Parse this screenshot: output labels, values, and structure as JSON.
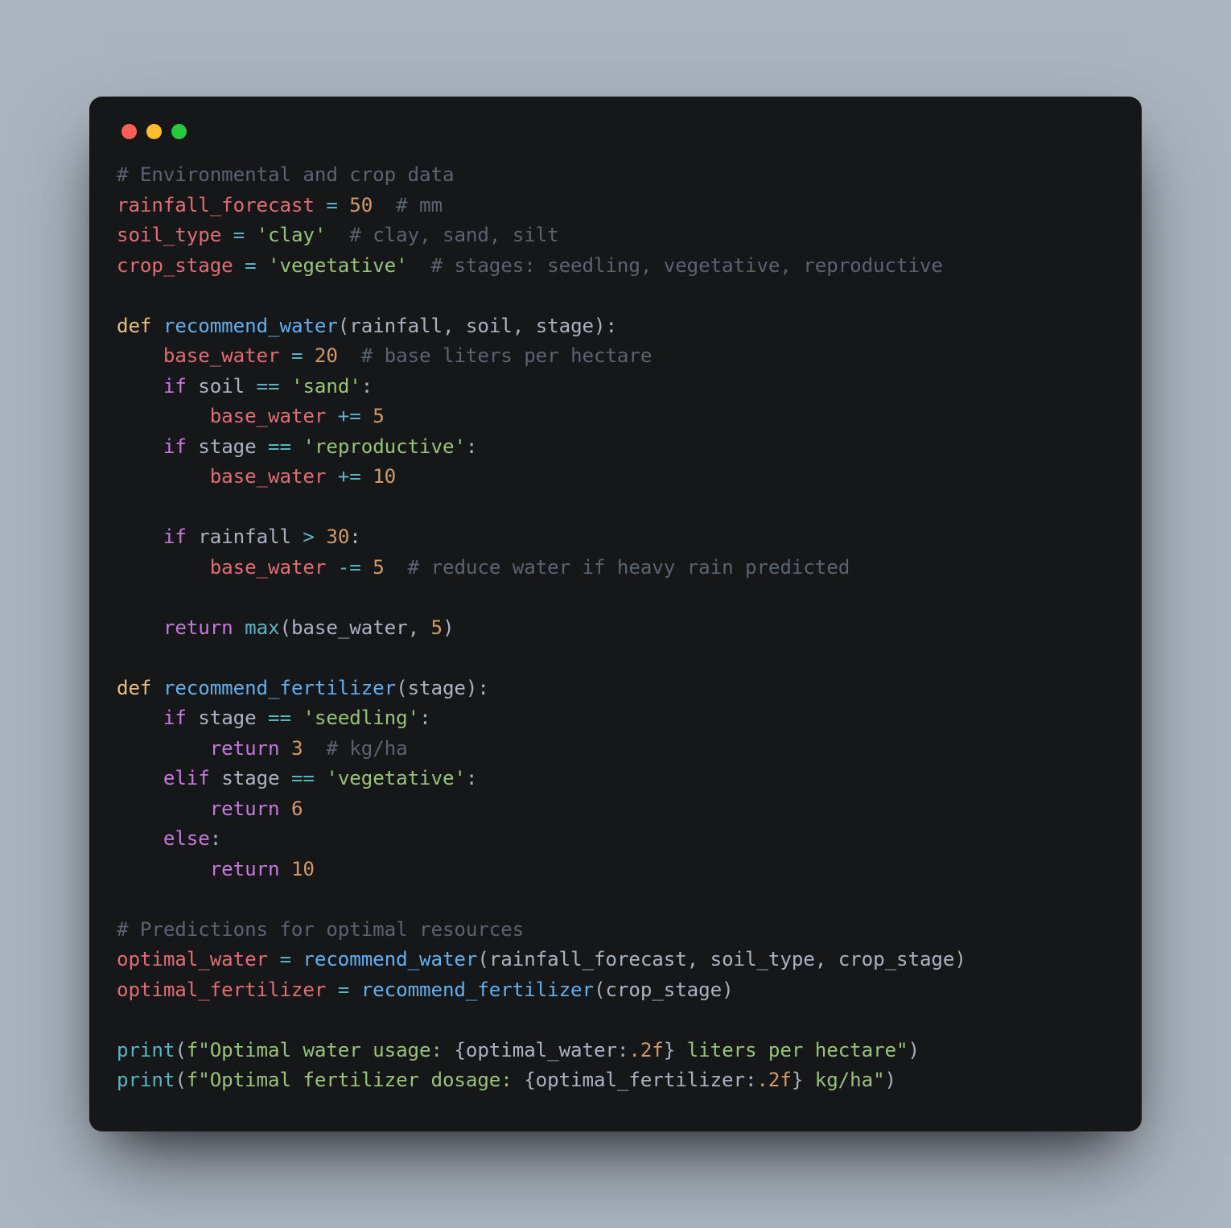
{
  "window": {
    "traffic_lights": [
      "red",
      "yellow",
      "green"
    ]
  },
  "code": {
    "c1": "# Environmental and crop data",
    "l2_var": "rainfall_forecast",
    "l2_num": "50",
    "l2_cmt": "# mm",
    "l3_var": "soil_type",
    "l3_str": "'clay'",
    "l3_cmt": "# clay, sand, silt",
    "l4_var": "crop_stage",
    "l4_str": "'vegetative'",
    "l4_cmt": "# stages: seedling, vegetative, reproductive",
    "kw_def": "def",
    "fn_rw": "recommend_water",
    "p_rainfall": "rainfall",
    "p_soil": "soil",
    "p_stage": "stage",
    "bw_var": "base_water",
    "num20": "20",
    "c_base": "# base liters per hectare",
    "kw_if": "if",
    "str_sand": "'sand'",
    "num5": "5",
    "str_repro": "'reproductive'",
    "num10": "10",
    "num30": "30",
    "c_reduce": "# reduce water if heavy rain predicted",
    "kw_return": "return",
    "fn_max": "max",
    "fn_rf": "recommend_fertilizer",
    "str_seedling": "'seedling'",
    "num3": "3",
    "c_kgha": "# kg/ha",
    "kw_elif": "elif",
    "str_veg": "'vegetative'",
    "num6": "6",
    "kw_else": "else",
    "c_pred": "# Predictions for optimal resources",
    "ow_var": "optimal_water",
    "of_var": "optimal_fertilizer",
    "fn_print": "print",
    "fstr1_a": "f\"Optimal water usage: ",
    "expr_ow": "{optimal_water",
    "fmt": ".2f",
    "close_brace": "}",
    "fstr1_b": " liters per hectare\"",
    "fstr2_a": "f\"Optimal fertilizer dosage: ",
    "expr_of": "{optimal_fertilizer",
    "fstr2_b": " kg/ha\"",
    "eq": " = ",
    "eqeq": " == ",
    "pluseq": " += ",
    "minuseq": " -= ",
    "gt": " > ",
    "colon": ":",
    "comma": ", ",
    "lp": "(",
    "rp": ")"
  }
}
